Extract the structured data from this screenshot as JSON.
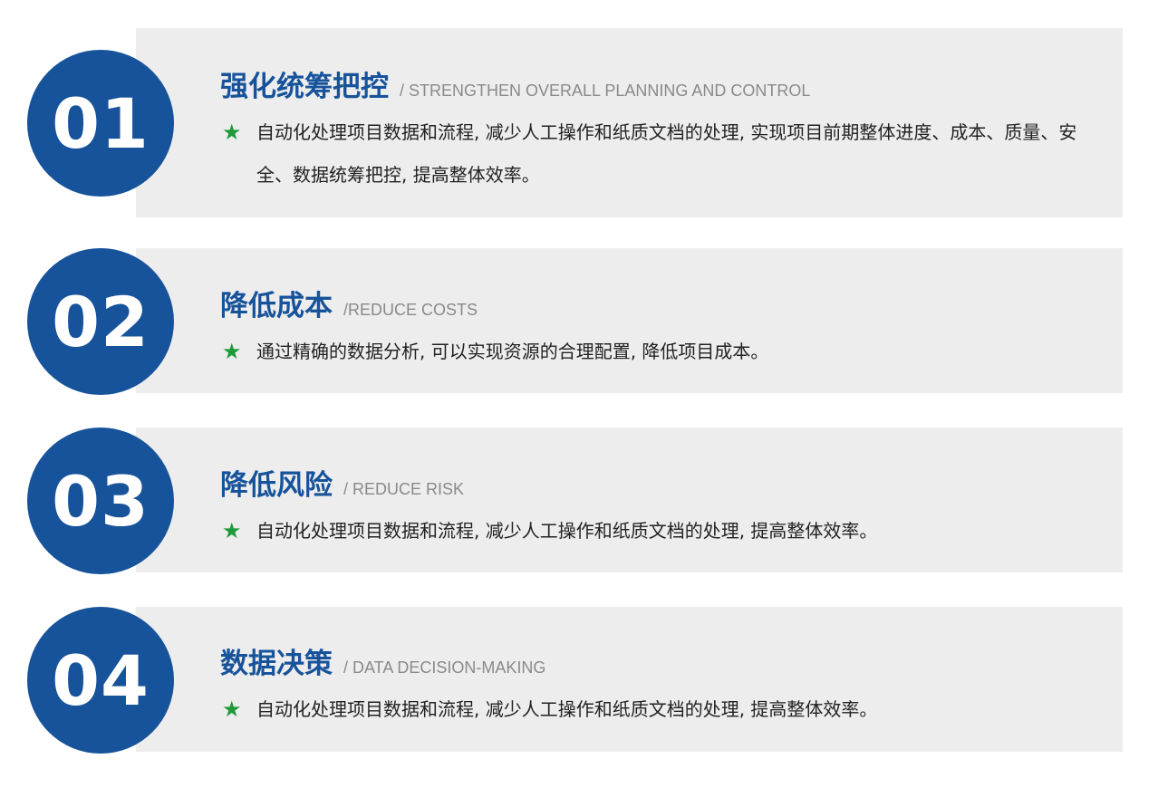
{
  "items": [
    {
      "number": "01",
      "title": "强化统筹把控",
      "subtitle": "/ STRENGTHEN OVERALL PLANNING AND CONTROL",
      "description": "自动化处理项目数据和流程, 减少人工操作和纸质文档的处理, 实现项目前期整体进度、成本、质量、安全、数据统筹把控, 提高整体效率。"
    },
    {
      "number": "02",
      "title": "降低成本",
      "subtitle": "/REDUCE COSTS",
      "description": "通过精确的数据分析, 可以实现资源的合理配置, 降低项目成本。"
    },
    {
      "number": "03",
      "title": "降低风险",
      "subtitle": "/ REDUCE RISK",
      "description": "自动化处理项目数据和流程, 减少人工操作和纸质文档的处理, 提高整体效率。"
    },
    {
      "number": "04",
      "title": "数据决策",
      "subtitle": "/ DATA DECISION-MAKING",
      "description": "自动化处理项目数据和流程, 减少人工操作和纸质文档的处理, 提高整体效率。"
    }
  ],
  "star_symbol": "★",
  "colors": {
    "badge": "#17539b",
    "title": "#17539b",
    "star": "#1f9a3b",
    "panel": "#ededed"
  }
}
